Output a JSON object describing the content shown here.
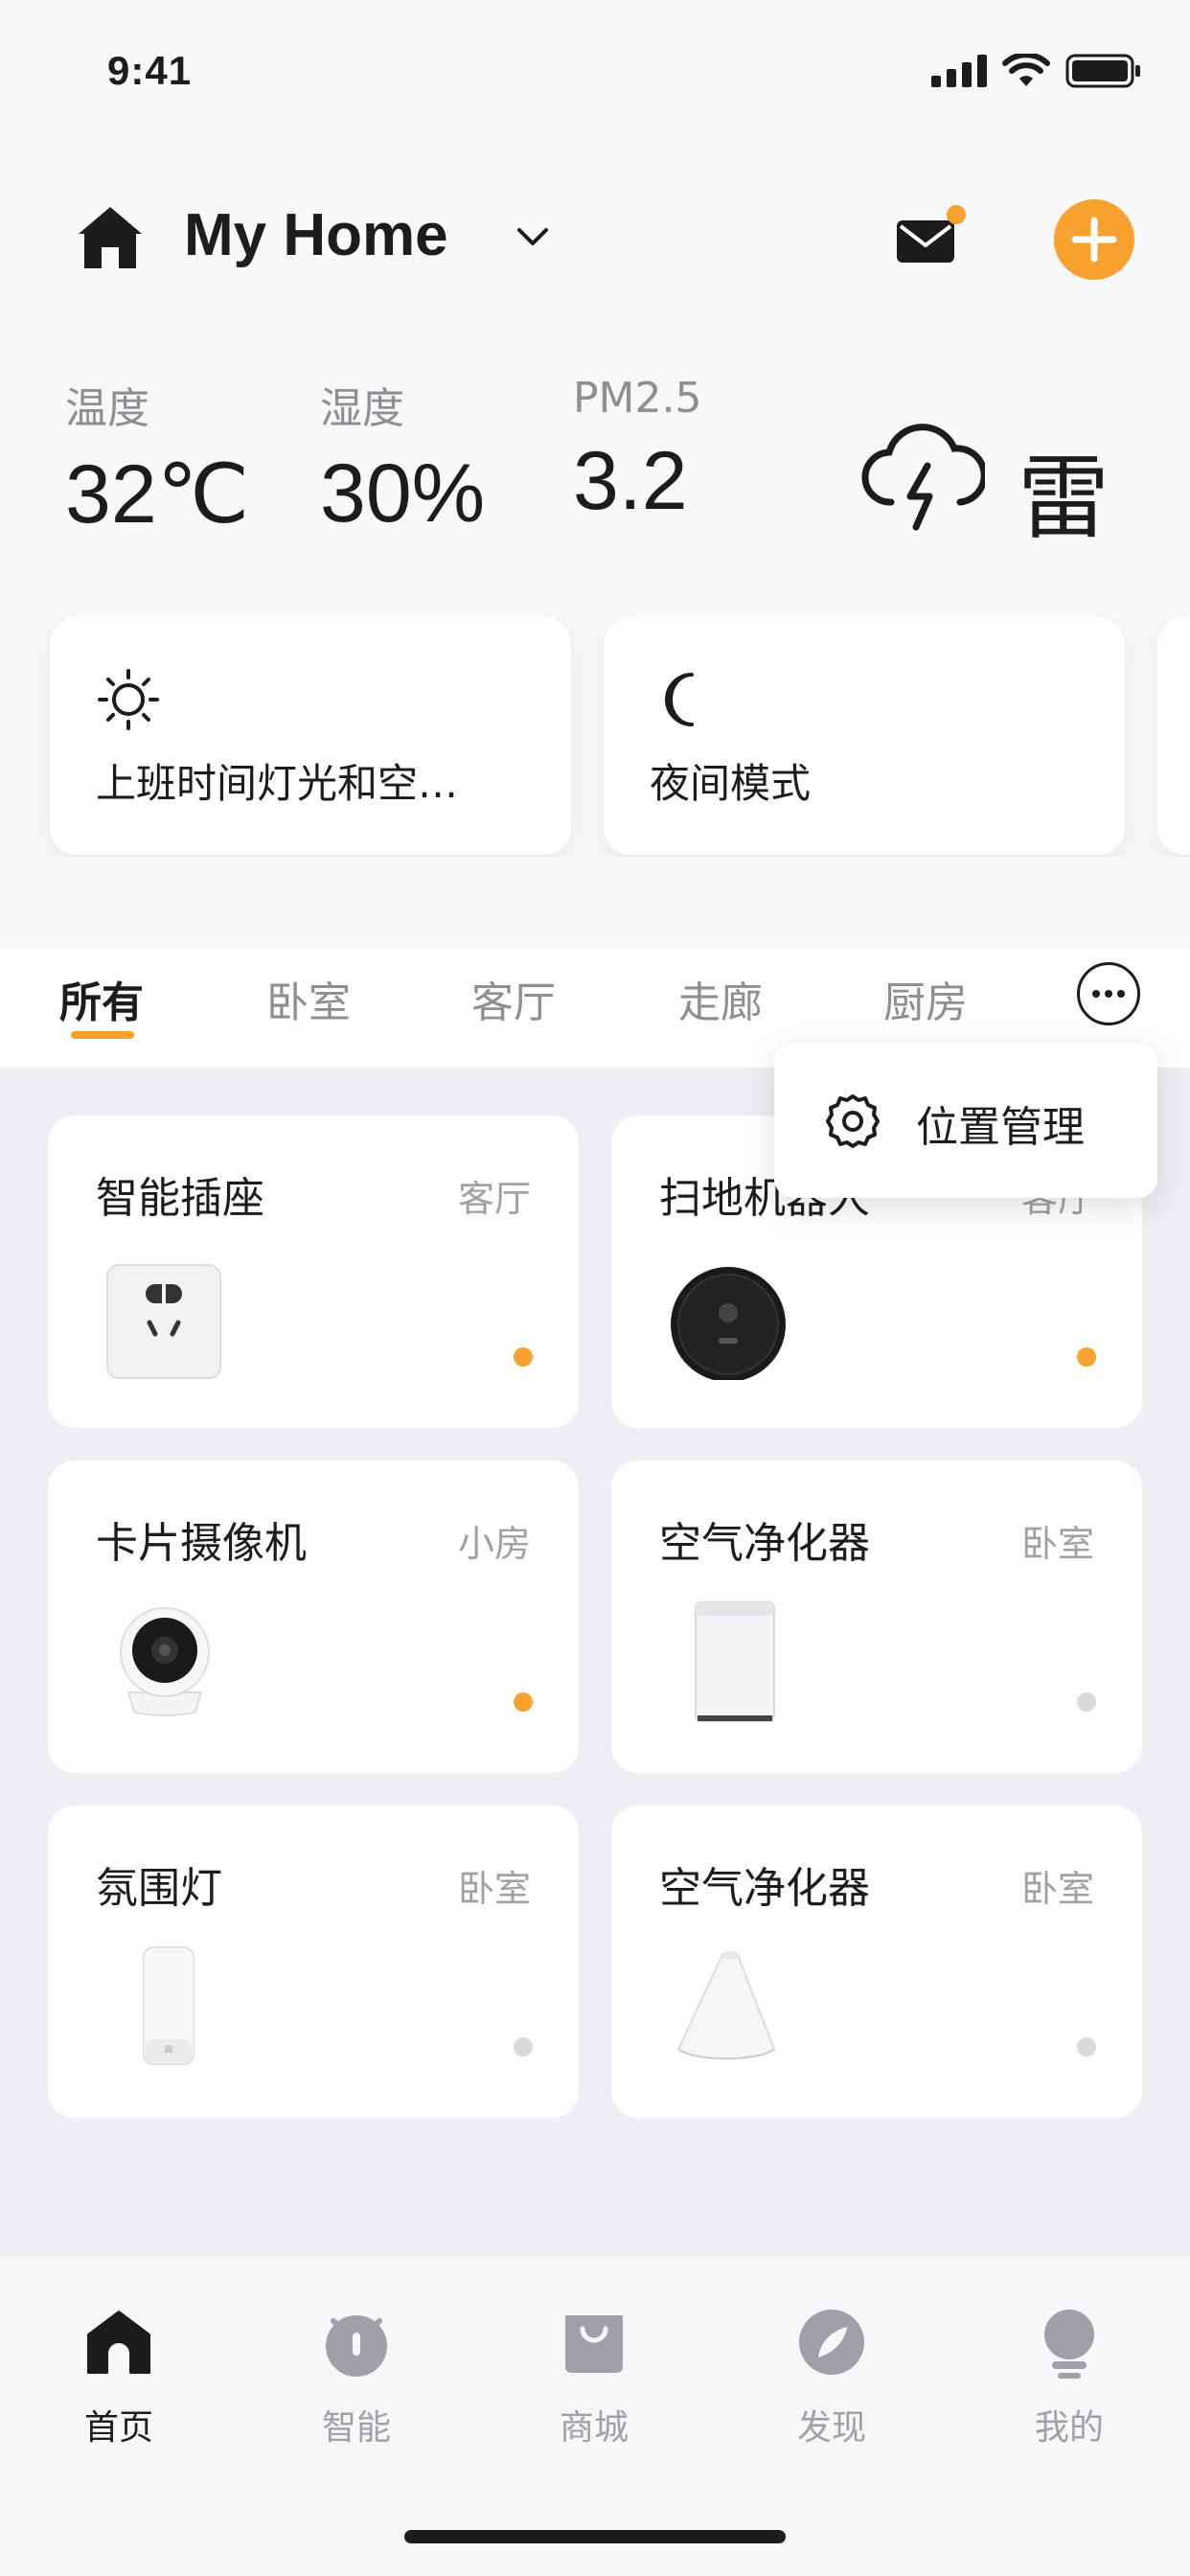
{
  "status_bar": {
    "time": "9:41"
  },
  "header": {
    "home_title": "My Home"
  },
  "environment": {
    "temperature_label": "温度",
    "temperature_value": "32℃",
    "humidity_label": "湿度",
    "humidity_value": "30%",
    "pm25_label": "PM2.5",
    "pm25_value": "3.2",
    "weather_text": "雷"
  },
  "scenes": [
    {
      "label": "上班时间灯光和空…",
      "icon": "sun-icon"
    },
    {
      "label": "夜间模式",
      "icon": "moon-icon"
    }
  ],
  "room_tabs": [
    "所有",
    "卧室",
    "客厅",
    "走廊",
    "厨房"
  ],
  "active_tab": "所有",
  "popup_menu": {
    "item_label": "位置管理"
  },
  "devices": [
    {
      "name": "智能插座",
      "room": "客厅",
      "online": true
    },
    {
      "name": "扫地机器人",
      "room": "客厅",
      "online": true
    },
    {
      "name": "卡片摄像机",
      "room": "小房",
      "online": true
    },
    {
      "name": "空气净化器",
      "room": "卧室",
      "online": false
    },
    {
      "name": "氛围灯",
      "room": "卧室",
      "online": false
    },
    {
      "name": "空气净化器",
      "room": "卧室",
      "online": false
    }
  ],
  "bottom_nav": [
    {
      "label": "首页",
      "icon": "home-icon"
    },
    {
      "label": "智能",
      "icon": "robot-icon"
    },
    {
      "label": "商城",
      "icon": "shopping-bag-icon"
    },
    {
      "label": "发现",
      "icon": "compass-icon"
    },
    {
      "label": "我的",
      "icon": "profile-icon"
    }
  ],
  "colors": {
    "accent": "#f7a12f",
    "online": "#f7a12f",
    "offline": "#d9d9de"
  }
}
